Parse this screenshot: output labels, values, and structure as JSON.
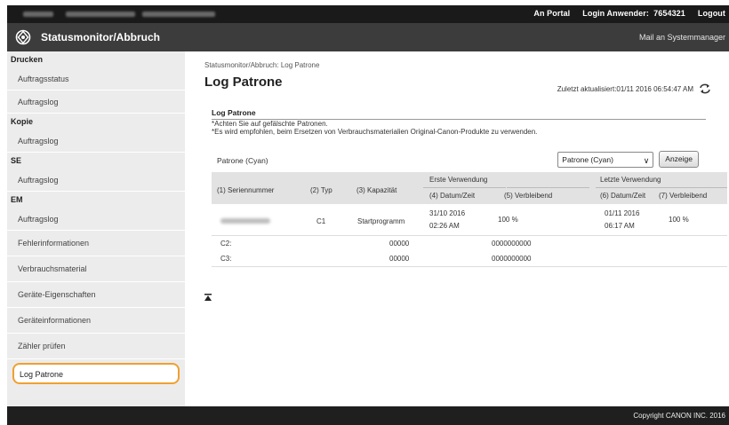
{
  "topbar": {
    "portal_link": "An Portal",
    "login_label": "Login Anwender:",
    "user_id": "7654321",
    "logout_link": "Logout"
  },
  "header": {
    "app_title": "Statusmonitor/Abbruch",
    "mail_link": "Mail an Systemmanager"
  },
  "sidebar": {
    "sections": [
      {
        "title": "Drucken",
        "items": [
          "Auftragsstatus",
          "Auftragslog"
        ]
      },
      {
        "title": "Kopie",
        "items": [
          "Auftragslog"
        ]
      },
      {
        "title": "SE",
        "items": [
          "Auftragslog"
        ]
      },
      {
        "title": "EM",
        "items": [
          "Auftragslog"
        ]
      }
    ],
    "links": [
      "Fehlerinformationen",
      "Verbrauchsmaterial",
      "Geräte-Eigenschaften",
      "Geräteinformationen",
      "Zähler prüfen"
    ],
    "active_link": "Log Patrone"
  },
  "main": {
    "breadcrumb": "Statusmonitor/Abbruch: Log Patrone",
    "page_title": "Log Patrone",
    "last_updated": "Zuletzt aktualisiert:01/11 2016 06:54:47 AM",
    "box_title": "Log Patrone",
    "note1": "*Achten Sie auf gefälschte Patronen.",
    "note2": "*Es wird empfohlen, beim Ersetzen von Verbrauchsmaterialien Original-Canon-Produkte zu verwenden.",
    "cartridge_label": "Patrone (Cyan)",
    "select_value": "Patrone (Cyan)",
    "display_button": "Anzeige"
  },
  "table": {
    "group_first_use": "Erste Verwendung",
    "group_last_use": "Letzte Verwendung",
    "columns": [
      "(1) Seriennummer",
      "(2) Typ",
      "(3) Kapazität",
      "(4) Datum/Zeit",
      "(5) Verbleibend",
      "(6) Datum/Zeit",
      "(7) Verbleibend"
    ],
    "rows": [
      {
        "serial": "",
        "type": "C1",
        "capacity": "Startprogramm",
        "first_date": "31/10 2016",
        "first_time": "02:26 AM",
        "first_remaining": "100 %",
        "last_date": "01/11 2016",
        "last_time": "06:17 AM",
        "last_remaining": "100 %"
      },
      {
        "serial": "",
        "type": "C2:",
        "capacity": "00000",
        "first_date": "",
        "first_time": "",
        "first_remaining": "0000000000",
        "last_date": "",
        "last_time": "",
        "last_remaining": ""
      },
      {
        "serial": "",
        "type": "C3:",
        "capacity": "00000",
        "first_date": "",
        "first_time": "",
        "first_remaining": "0000000000",
        "last_date": "",
        "last_time": "",
        "last_remaining": ""
      }
    ]
  },
  "footer": {
    "copyright": "Copyright CANON INC. 2016"
  },
  "colors": {
    "topbar_bg": "#1a1a1a",
    "header_bg": "#3c3c3c",
    "sidebar_bg": "#ececec",
    "active_outline": "#f0a030",
    "table_header_bg": "#e2e2e2",
    "footer_bg": "#1f1f1f"
  },
  "icons": {
    "logo": "canon-logo-icon",
    "refresh": "refresh-icon",
    "back_to_top": "arrow-up-to-top-icon",
    "dropdown": "chevron-down-icon"
  }
}
